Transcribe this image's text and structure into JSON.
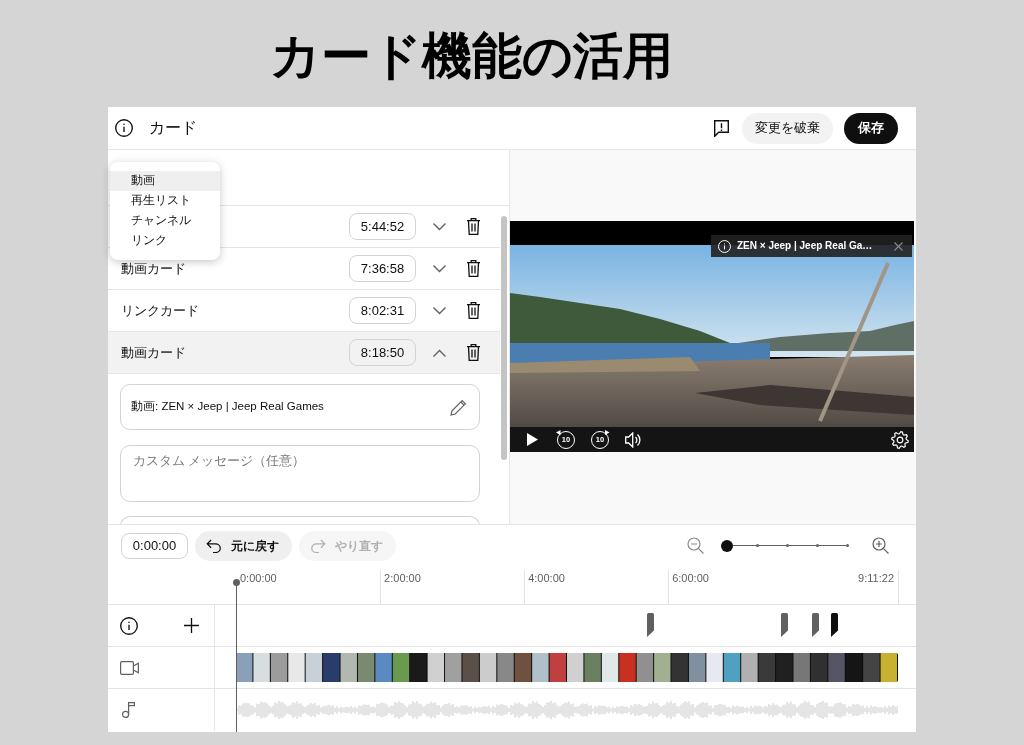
{
  "title": "カード機能の活用",
  "header": {
    "title": "カード",
    "buttons": [
      {
        "label": "変更を破棄",
        "kind": "secondary"
      },
      {
        "label": "保存",
        "kind": "primary"
      }
    ]
  },
  "add_menu": {
    "items": [
      {
        "label": "動画",
        "selected": true
      },
      {
        "label": "再生リスト",
        "selected": false
      },
      {
        "label": "チャンネル",
        "selected": false
      },
      {
        "label": "リンク",
        "selected": false
      }
    ]
  },
  "cards": [
    {
      "time": "5:44:52",
      "expanded": false
    },
    {
      "label": "動画カード",
      "time": "7:36:58",
      "expanded": false
    },
    {
      "label": "リンクカード",
      "time": "8:02:31",
      "expanded": false
    },
    {
      "label": "動画カード",
      "time": "8:18:50",
      "expanded": true,
      "details": {
        "video": "動画: ZEN × Jeep | Jeep Real Games",
        "message_placeholder": "カスタム メッセージ（任意）"
      }
    }
  ],
  "player": {
    "card_teaser": "ZEN × Jeep | Jeep Real Ga…",
    "rewind_label": "10",
    "forward_label": "10"
  },
  "toolbar": {
    "time": "0:00:00",
    "undo": {
      "label": "元に戻す",
      "disabled": false
    },
    "redo": {
      "label": "やり直す",
      "disabled": true
    },
    "zoom": {
      "level": 0
    }
  },
  "timeline": {
    "ruler": [
      "0:00:00",
      "2:00:00",
      "4:00:00",
      "6:00:00",
      "9:11:22"
    ]
  }
}
